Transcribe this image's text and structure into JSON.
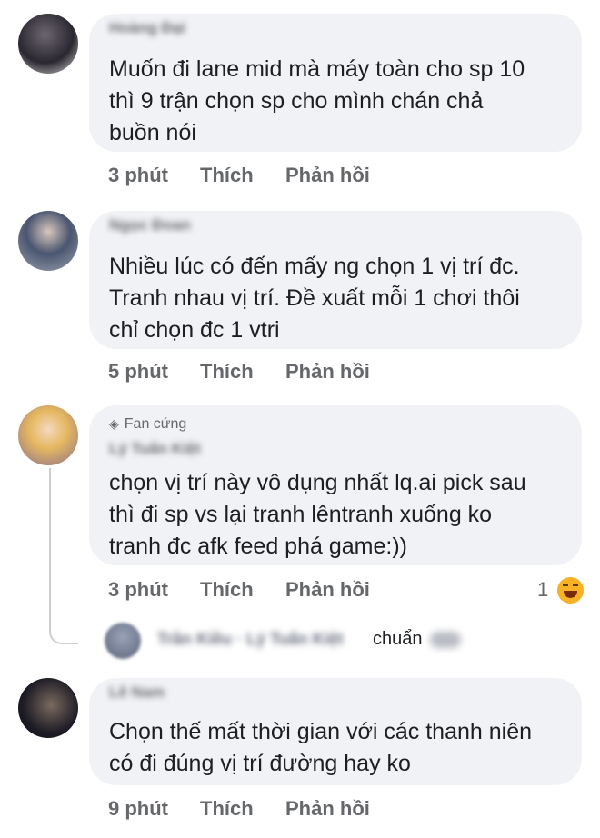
{
  "comments": [
    {
      "author": "Hoàng Đại",
      "text": "Muốn đi lane mid mà máy toàn cho sp 10\nthì 9 trận chọn sp cho mình chán chả\nbuồn nói",
      "time": "3 phút",
      "like": "Thích",
      "reply": "Phản hồi"
    },
    {
      "author": "Ngọc Đoan",
      "text": "Nhiều lúc có đến mấy ng chọn 1 vị trí đc.\nTranh nhau vị trí. Đề xuất mỗi 1  chơi thôi\nchỉ chọn đc 1 vtri",
      "time": "5 phút",
      "like": "Thích",
      "reply": "Phản hồi"
    },
    {
      "badge": "Fan cứng",
      "author": "Lý Tuấn Kiệt",
      "text": "chọn vị trí này vô dụng nhất lq.ai pick sau\nthì đi sp vs lại tranh lêntranh xuống ko\ntranh đc afk feed phá game:))",
      "time": "3 phút",
      "like": "Thích",
      "reply": "Phản hồi",
      "reaction_count": "1",
      "reply_preview": {
        "author": "Trần Kiều · Lý Tuấn Kiệt",
        "text": "chuẩn"
      }
    },
    {
      "author": "Lê Nam",
      "text": "Chọn  thế mất thời gian với các thanh niên\ncó đi đúng vị trí đường hay ko",
      "time": "9 phút",
      "like": "Thích",
      "reply": "Phản hồi"
    }
  ],
  "icons": {
    "badge": "diamond-icon",
    "reaction": "haha-reaction-icon"
  }
}
